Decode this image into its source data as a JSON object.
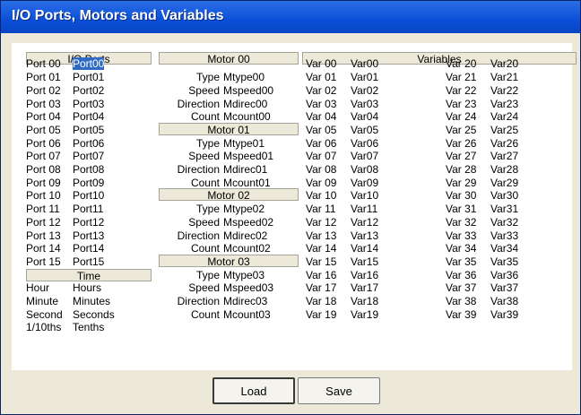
{
  "window": {
    "title": "I/O Ports, Motors and Variables"
  },
  "io": {
    "header": "I/O Ports",
    "ports": [
      {
        "label": "Port 00",
        "value": "Port00"
      },
      {
        "label": "Port 01",
        "value": "Port01"
      },
      {
        "label": "Port 02",
        "value": "Port02"
      },
      {
        "label": "Port 03",
        "value": "Port03"
      },
      {
        "label": "Port 04",
        "value": "Port04"
      },
      {
        "label": "Port 05",
        "value": "Port05"
      },
      {
        "label": "Port 06",
        "value": "Port06"
      },
      {
        "label": "Port 07",
        "value": "Port07"
      },
      {
        "label": "Port 08",
        "value": "Port08"
      },
      {
        "label": "Port 09",
        "value": "Port09"
      },
      {
        "label": "Port 10",
        "value": "Port10"
      },
      {
        "label": "Port 11",
        "value": "Port11"
      },
      {
        "label": "Port 12",
        "value": "Port12"
      },
      {
        "label": "Port 13",
        "value": "Port13"
      },
      {
        "label": "Port 14",
        "value": "Port14"
      },
      {
        "label": "Port 15",
        "value": "Port15"
      }
    ]
  },
  "time": {
    "header": "Time",
    "rows": [
      {
        "label": "Hour",
        "value": "Hours"
      },
      {
        "label": "Minute",
        "value": "Minutes"
      },
      {
        "label": "Second",
        "value": "Seconds"
      },
      {
        "label": "1/10ths",
        "value": "Tenths"
      }
    ]
  },
  "motors": [
    {
      "header": "Motor 00",
      "rows": [
        {
          "label": "Type",
          "value": "Mtype00"
        },
        {
          "label": "Speed",
          "value": "Mspeed00"
        },
        {
          "label": "Direction",
          "value": "Mdirec00"
        },
        {
          "label": "Count",
          "value": "Mcount00"
        }
      ]
    },
    {
      "header": "Motor 01",
      "rows": [
        {
          "label": "Type",
          "value": "Mtype01"
        },
        {
          "label": "Speed",
          "value": "Mspeed01"
        },
        {
          "label": "Direction",
          "value": "Mdirec01"
        },
        {
          "label": "Count",
          "value": "Mcount01"
        }
      ]
    },
    {
      "header": "Motor 02",
      "rows": [
        {
          "label": "Type",
          "value": "Mtype02"
        },
        {
          "label": "Speed",
          "value": "Mspeed02"
        },
        {
          "label": "Direction",
          "value": "Mdirec02"
        },
        {
          "label": "Count",
          "value": "Mcount02"
        }
      ]
    },
    {
      "header": "Motor 03",
      "rows": [
        {
          "label": "Type",
          "value": "Mtype03"
        },
        {
          "label": "Speed",
          "value": "Mspeed03"
        },
        {
          "label": "Direction",
          "value": "Mdirec03"
        },
        {
          "label": "Count",
          "value": "Mcount03"
        }
      ]
    }
  ],
  "variables": {
    "header": "Variables",
    "items": [
      {
        "label": "Var 00",
        "value": "Var00"
      },
      {
        "label": "Var 01",
        "value": "Var01"
      },
      {
        "label": "Var 02",
        "value": "Var02"
      },
      {
        "label": "Var 03",
        "value": "Var03"
      },
      {
        "label": "Var 04",
        "value": "Var04"
      },
      {
        "label": "Var 05",
        "value": "Var05"
      },
      {
        "label": "Var 06",
        "value": "Var06"
      },
      {
        "label": "Var 07",
        "value": "Var07"
      },
      {
        "label": "Var 08",
        "value": "Var08"
      },
      {
        "label": "Var 09",
        "value": "Var09"
      },
      {
        "label": "Var 10",
        "value": "Var10"
      },
      {
        "label": "Var 11",
        "value": "Var11"
      },
      {
        "label": "Var 12",
        "value": "Var12"
      },
      {
        "label": "Var 13",
        "value": "Var13"
      },
      {
        "label": "Var 14",
        "value": "Var14"
      },
      {
        "label": "Var 15",
        "value": "Var15"
      },
      {
        "label": "Var 16",
        "value": "Var16"
      },
      {
        "label": "Var 17",
        "value": "Var17"
      },
      {
        "label": "Var 18",
        "value": "Var18"
      },
      {
        "label": "Var 19",
        "value": "Var19"
      },
      {
        "label": "Var 20",
        "value": "Var20"
      },
      {
        "label": "Var 21",
        "value": "Var21"
      },
      {
        "label": "Var 22",
        "value": "Var22"
      },
      {
        "label": "Var 23",
        "value": "Var23"
      },
      {
        "label": "Var 24",
        "value": "Var24"
      },
      {
        "label": "Var 25",
        "value": "Var25"
      },
      {
        "label": "Var 26",
        "value": "Var26"
      },
      {
        "label": "Var 27",
        "value": "Var27"
      },
      {
        "label": "Var 28",
        "value": "Var28"
      },
      {
        "label": "Var 29",
        "value": "Var29"
      },
      {
        "label": "Var 30",
        "value": "Var30"
      },
      {
        "label": "Var 31",
        "value": "Var31"
      },
      {
        "label": "Var 32",
        "value": "Var32"
      },
      {
        "label": "Var 33",
        "value": "Var33"
      },
      {
        "label": "Var 34",
        "value": "Var34"
      },
      {
        "label": "Var 35",
        "value": "Var35"
      },
      {
        "label": "Var 36",
        "value": "Var36"
      },
      {
        "label": "Var 37",
        "value": "Var37"
      },
      {
        "label": "Var 38",
        "value": "Var38"
      },
      {
        "label": "Var 39",
        "value": "Var39"
      }
    ]
  },
  "buttons": {
    "load": "Load",
    "save": "Save"
  }
}
